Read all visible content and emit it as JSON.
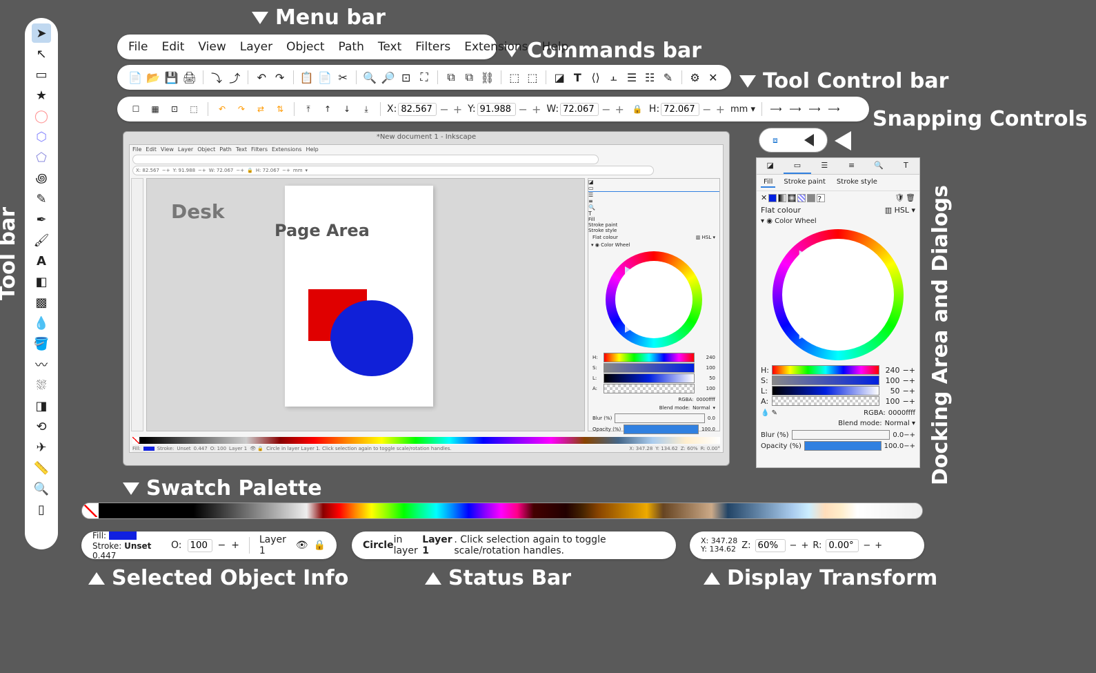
{
  "labels": {
    "menubar": "Menu bar",
    "commands": "Commands bar",
    "toolcontrol": "Tool Control bar",
    "snapping": "Snapping Controls",
    "toolbar": "Tool bar",
    "docking": "Docking Area and Dialogs",
    "swatch": "Swatch Palette",
    "selinfo": "Selected Object Info",
    "status": "Status Bar",
    "disptf": "Display Transform",
    "desk": "Desk",
    "page": "Page Area"
  },
  "menu": [
    "File",
    "Edit",
    "View",
    "Layer",
    "Object",
    "Path",
    "Text",
    "Filters",
    "Extensions",
    "Help"
  ],
  "window_title": "*New document 1 - Inkscape",
  "tcbar": {
    "x_label": "X:",
    "x": "82.567",
    "y_label": "Y:",
    "y": "91.988",
    "w_label": "W:",
    "w": "72.067",
    "h_label": "H:",
    "h": "72.067",
    "unit": "mm"
  },
  "dock": {
    "subtabs": {
      "fill": "Fill",
      "stroke_paint": "Stroke paint",
      "stroke_style": "Stroke style"
    },
    "flat": "Flat colour",
    "hsl": "HSL",
    "color_wheel": "Color Wheel",
    "h": "H:",
    "s": "S:",
    "l": "L:",
    "a": "A:",
    "hv": "240",
    "sv": "100",
    "lv": "50",
    "av": "100",
    "rgba_label": "RGBA:",
    "rgba": "0000ffff",
    "blend_label": "Blend mode:",
    "blend": "Normal",
    "blur_label": "Blur (%)",
    "blur": "0.0",
    "opacity_label": "Opacity (%)",
    "opacity": "100.0"
  },
  "selinfo": {
    "fill_label": "Fill:",
    "stroke_label": "Stroke:",
    "stroke_val": "Unset",
    "stroke_w": "0.447",
    "o_label": "O:",
    "o": "100",
    "layer": "Layer 1"
  },
  "status": {
    "object": "Circle",
    "in": " in layer ",
    "layer": "Layer 1",
    "rest": ". Click selection again to toggle scale/rotation handles."
  },
  "display": {
    "x_label": "X:",
    "x": "347.28",
    "y_label": "Y:",
    "y": "134.62",
    "z_label": "Z:",
    "z": "60%",
    "r_label": "R:",
    "r": "0.00°"
  },
  "scr_tcbar": {
    "x": "X: 82.567",
    "y": "Y: 91.988",
    "w": "W: 72.067",
    "h": "H: 72.067",
    "u": "mm"
  },
  "scr_dock": {
    "hv": "240",
    "sv": "100",
    "lv": "50",
    "av": "100",
    "rgba": "0000ffff",
    "blend": "Normal",
    "blur": "0.0",
    "op": "100.0"
  },
  "scr_status": {
    "fill": "Fill:",
    "stroke": "Stroke:",
    "unset": "Unset",
    "sw": "0.447",
    "o": "O: 100",
    "layer": "Layer 1",
    "msg": "Circle in layer Layer 1. Click selection again to toggle scale/rotation handles.",
    "x": "X: 347.28",
    "y": "Y: 134.62",
    "z": "Z: 60%",
    "r": "R: 0.00°"
  }
}
